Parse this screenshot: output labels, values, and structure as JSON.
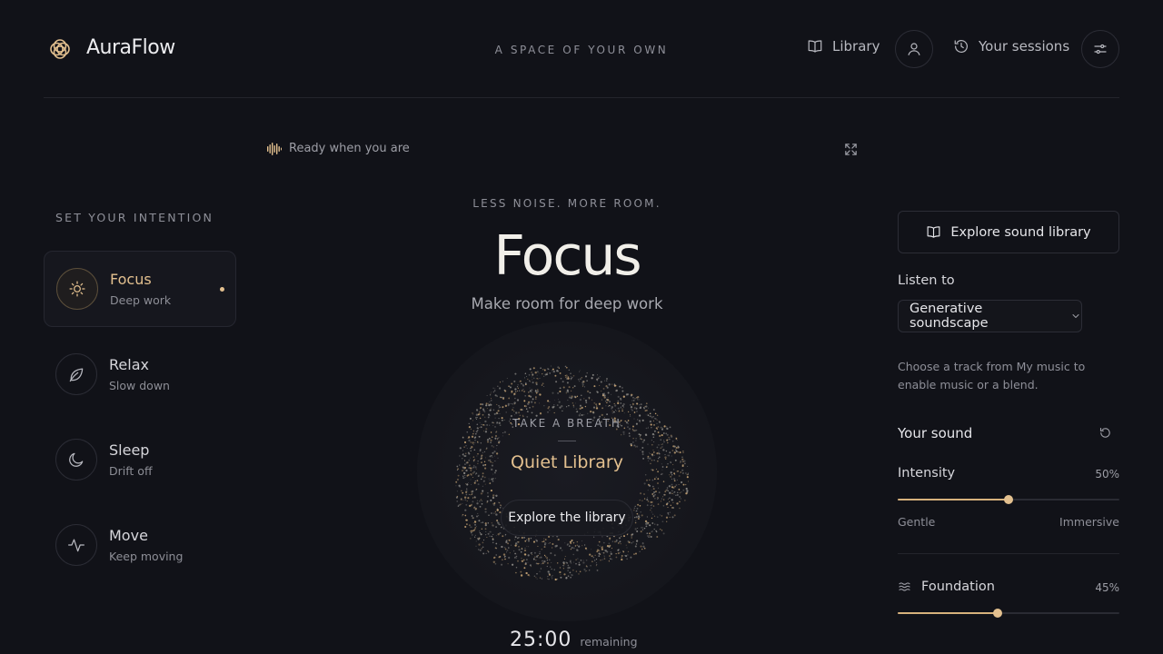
{
  "header": {
    "brand": "AuraFlow",
    "tagline": "A SPACE OF YOUR OWN",
    "library_label": "Library",
    "sessions_label": "Your sessions"
  },
  "status": {
    "text": "Ready when you are"
  },
  "intention": {
    "heading": "SET YOUR INTENTION",
    "modes": [
      {
        "title": "Focus",
        "subtitle": "Deep work",
        "icon": "sun-icon",
        "active": true
      },
      {
        "title": "Relax",
        "subtitle": "Slow down",
        "icon": "leaf-icon",
        "active": false
      },
      {
        "title": "Sleep",
        "subtitle": "Drift off",
        "icon": "moon-icon",
        "active": false
      },
      {
        "title": "Move",
        "subtitle": "Keep moving",
        "icon": "pulse-icon",
        "active": false
      }
    ]
  },
  "center": {
    "kicker": "LESS NOISE. MORE ROOM.",
    "title": "Focus",
    "subtitle": "Make room for deep work",
    "breath": "TAKE A BREATH",
    "track_name": "Quiet Library",
    "explore_button": "Explore the library",
    "timer": "25:00",
    "timer_label": "remaining"
  },
  "panel": {
    "explore_library": "Explore sound library",
    "listen_to_label": "Listen to",
    "listen_to_value": "Generative soundscape",
    "help_text": "Choose a track from My music to enable music or a blend.",
    "your_sound": "Your sound",
    "intensity": {
      "label": "Intensity",
      "value_text": "50%",
      "value": 0.5,
      "min_label": "Gentle",
      "max_label": "Immersive"
    },
    "foundation": {
      "label": "Foundation",
      "value_text": "45%",
      "value": 0.45
    }
  },
  "colors": {
    "accent": "#e3c08f",
    "background": "#111218"
  }
}
